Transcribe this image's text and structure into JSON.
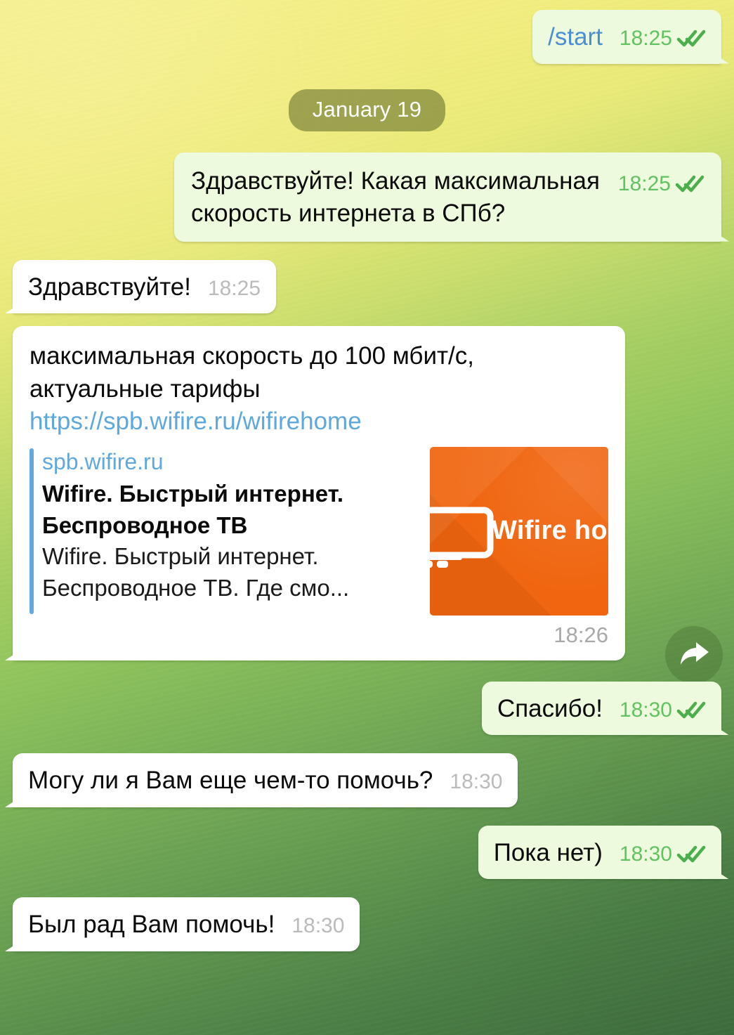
{
  "theme": {
    "bg_top": "#f6f08a",
    "bg_bottom": "#3f6d3e",
    "outgoing_bubble": "#eefadd",
    "incoming_bubble": "#ffffff",
    "link_blue": "#5fa8dd",
    "check_green": "#62c262",
    "preview_orange": "#f0650f",
    "date_pill": "rgba(108,118,48,.62)"
  },
  "date_divider": {
    "label": "January 19"
  },
  "messages": [
    {
      "id": "start-command",
      "direction": "out",
      "text": "/start",
      "time": "18:25",
      "status": "read"
    },
    {
      "id": "question-speed",
      "direction": "out",
      "line1": "Здравствуйте! Какая максимальная",
      "line2": "скорость интернета в СПб?",
      "text": "Здравствуйте! Какая максимальная скорость интернета в СПб?",
      "time": "18:25",
      "status": "read"
    },
    {
      "id": "greeting-reply",
      "direction": "in",
      "text": "Здравствуйте!",
      "time": "18:25"
    },
    {
      "id": "answer-with-link",
      "direction": "in",
      "line1": "максимальная скорость до 100 мбит/с,",
      "line2": "актуальные тарифы",
      "link": "https://spb.wifire.ru/wifirehome",
      "time": "18:26",
      "preview": {
        "site": "spb.wifire.ru",
        "title_line1": "Wifire. Быстрый интернет.",
        "title_line2": "Беспроводное ТВ",
        "desc_line1": "Wifire. Быстрый интернет.",
        "desc_line2": "Беспроводное ТВ. Где смо...",
        "image_brand": "Wifire home",
        "image_icon": "monitor-icon"
      }
    },
    {
      "id": "thanks",
      "direction": "out",
      "text": "Спасибо!",
      "time": "18:30",
      "status": "read"
    },
    {
      "id": "anything-else",
      "direction": "in",
      "text": "Могу ли я Вам еще чем-то помочь?",
      "time": "18:30"
    },
    {
      "id": "no-thanks",
      "direction": "out",
      "text": "Пока нет)",
      "time": "18:30",
      "status": "read"
    },
    {
      "id": "glad-to-help",
      "direction": "in",
      "text": "Был рад Вам помочь!",
      "time": "18:30"
    }
  ],
  "forward_button": {
    "icon": "forward-arrow-icon"
  }
}
